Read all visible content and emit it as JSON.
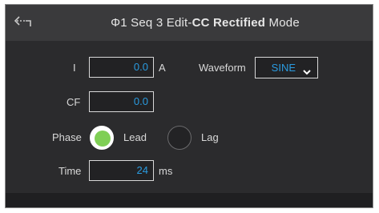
{
  "header": {
    "title_prefix": "Φ1 Seq 3 Edit-",
    "title_bold": "CC Rectified",
    "title_suffix": " Mode"
  },
  "form": {
    "current": {
      "label": "I",
      "value": "0.0",
      "unit": "A"
    },
    "waveform": {
      "label": "Waveform",
      "value": "SINE"
    },
    "cf": {
      "label": "CF",
      "value": "0.0"
    },
    "phase": {
      "label": "Phase",
      "options": [
        {
          "label": "Lead",
          "selected": true
        },
        {
          "label": "Lag",
          "selected": false
        }
      ]
    },
    "time": {
      "label": "Time",
      "value": "24",
      "unit": "ms"
    }
  },
  "colors": {
    "value_text": "#2a9be0",
    "radio_selected": "#7fcf55",
    "header_bg": "#3a3a3c",
    "panel_bg": "#2b2b2d"
  },
  "icons": {
    "back": "back-arrow-icon",
    "dropdown": "chevron-down-icon"
  }
}
